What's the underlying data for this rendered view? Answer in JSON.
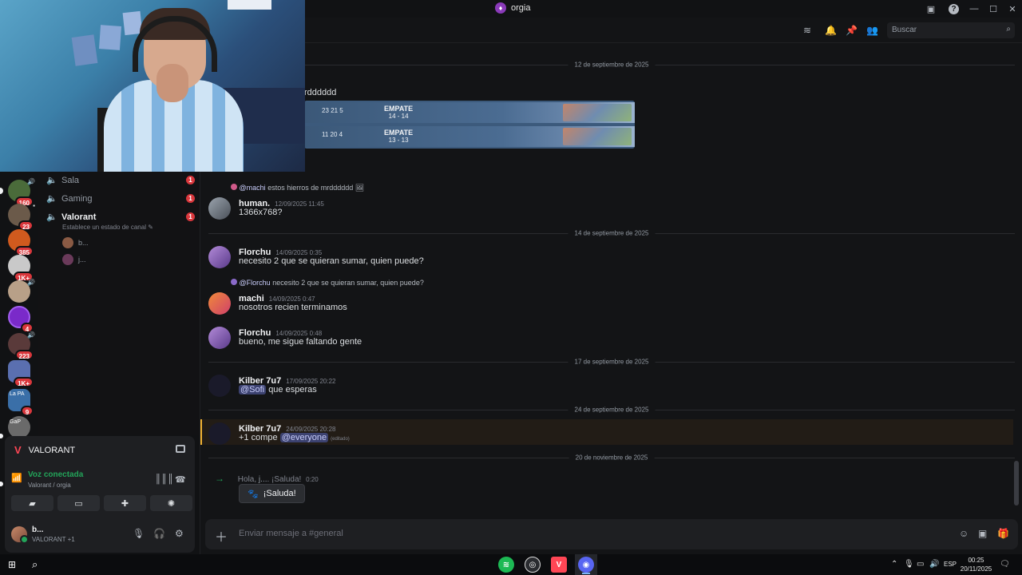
{
  "window": {
    "title": "orgia",
    "title_icon": "server-icon"
  },
  "rail": {
    "servers": [
      {
        "badge": "160",
        "color": "#4a6b3a"
      },
      {
        "badge": "23",
        "color": "#6b5a4a"
      },
      {
        "badge": "385",
        "color": "#d05a1e"
      },
      {
        "badge": "1K+",
        "color": "#c9c9c9"
      },
      {
        "badge": "",
        "color": "#b8a088"
      },
      {
        "badge": "4",
        "color": "#7a2ac9"
      },
      {
        "badge": "223",
        "color": "#5a3a3a"
      },
      {
        "badge": "1K+",
        "color": "#5a6fb0"
      },
      {
        "badge": "9",
        "color": "#3a6fa8"
      },
      {
        "badge": "",
        "color": "#6a6a6a"
      }
    ],
    "server_labels": {
      "la": "La",
      "pa": "PA",
      "gap": "GaP"
    }
  },
  "channels": {
    "items": [
      {
        "name": "Sala",
        "unread": "1"
      },
      {
        "name": "Gaming",
        "unread": "1"
      },
      {
        "name": "Valorant",
        "unread": "1"
      }
    ],
    "status_placeholder": "Establece un estado de canal",
    "voice_users": [
      "b...",
      "j..."
    ]
  },
  "voice_panel": {
    "game": "VALORANT",
    "status": "Voz conectada",
    "location": "Valorant / orgia",
    "user_name": "b...",
    "user_activity": "VALORANT +1"
  },
  "header": {
    "search_placeholder": "Buscar"
  },
  "messages": {
    "dates": [
      "12 de septiembre de 2025",
      "14 de septiembre de 2025",
      "17 de septiembre de 2025",
      "24 de septiembre de 2025",
      "20 de noviembre de 2025"
    ],
    "partial_text": "rdddddd",
    "embed": [
      {
        "score": "23 21 5",
        "result": "EMPATE",
        "rounds": "14 - 14"
      },
      {
        "score": "11 20 4",
        "result": "EMPATE",
        "rounds": "13 - 13"
      }
    ],
    "m1": {
      "reply_user": "@machi",
      "reply_text": "estos hierros de mrdddddd",
      "user": "human.",
      "time": "12/09/2025 11:45",
      "text": "1366x768?"
    },
    "m2": {
      "user": "Florchu",
      "time": "14/09/2025 0:35",
      "text": "necesito 2 que se quieran sumar, quien puede?"
    },
    "m3": {
      "reply_user": "@Florchu",
      "reply_text": "necesito 2 que se quieran sumar, quien puede?",
      "user": "machi",
      "time": "14/09/2025 0:47",
      "text": "nosotros recien terminamos"
    },
    "m4": {
      "user": "Florchu",
      "time": "14/09/2025 0:48",
      "text": "bueno, me sigue faltando gente"
    },
    "m5": {
      "user": "Kilber 7u7",
      "time": "17/09/2025 20:22",
      "mention": "@Sofi",
      "text": "que esperas"
    },
    "m6": {
      "user": "Kilber 7u7",
      "time": "24/09/2025 20:28",
      "text_pre": "+1 compe",
      "mention": "@everyone",
      "edited": "(editado)"
    },
    "m7": {
      "greeting": "Hola,",
      "user": "j...",
      "suffix": ". ¡Saluda!",
      "time": "0:20",
      "wave_label": "¡Saluda!"
    }
  },
  "composer": {
    "placeholder": "Enviar mensaje a #general"
  },
  "taskbar": {
    "lang": "ESP",
    "time": "00:25",
    "date": "20/11/2025"
  },
  "colors": {
    "accent_green": "#23a55a",
    "badge_red": "#da373c",
    "mention_bg": "#3c4270",
    "highlight_bar": "#f0b232"
  }
}
